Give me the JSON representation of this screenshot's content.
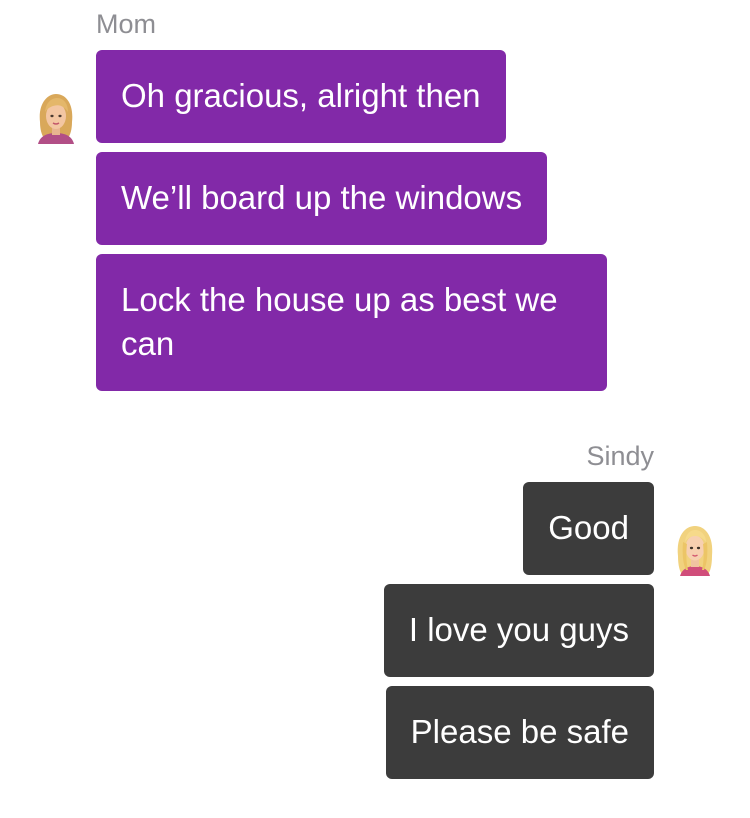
{
  "thread": {
    "mom": {
      "name": "Mom",
      "avatar_icon": "woman-blonde-avatar-icon",
      "bubble_color": "#8229a8",
      "messages": [
        "Oh gracious, alright then",
        "We’ll board up the windows",
        "Lock the house up as best we can"
      ]
    },
    "sindy": {
      "name": "Sindy",
      "avatar_icon": "girl-blonde-avatar-icon",
      "bubble_color": "#3c3c3c",
      "messages": [
        "Good",
        "I love you guys",
        "Please be safe"
      ]
    }
  }
}
